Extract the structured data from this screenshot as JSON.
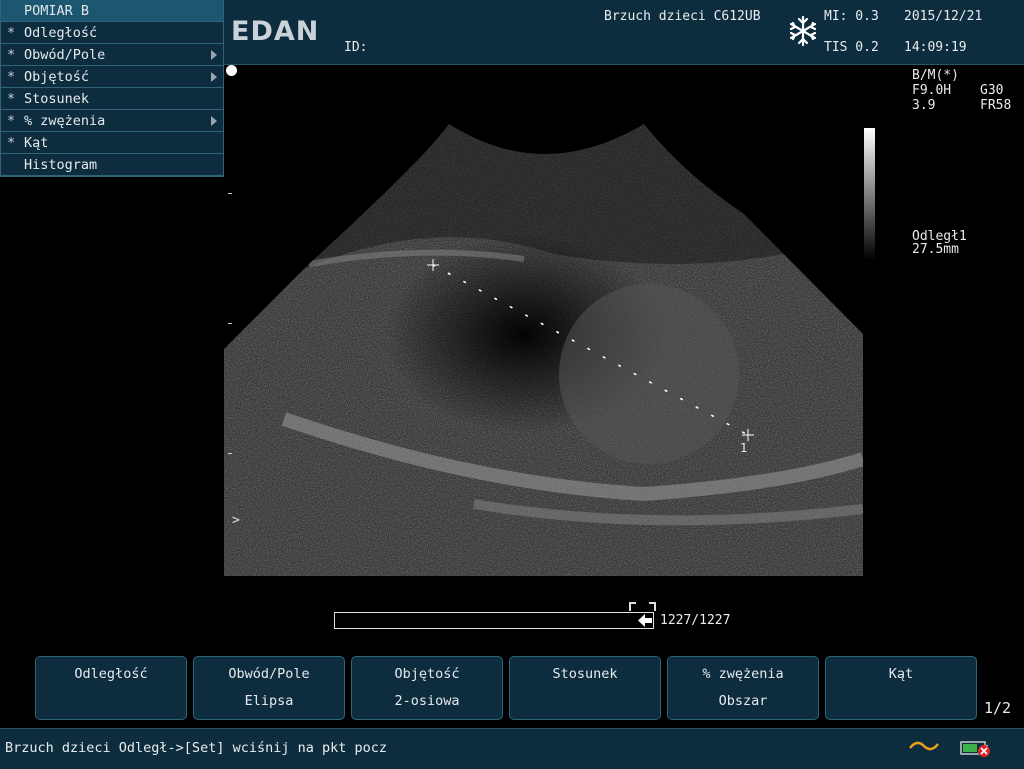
{
  "header": {
    "logo": "EDAN",
    "id_label": "ID:",
    "exam_name": "Brzuch dzieci C612UB",
    "mi": "MI: 0.3",
    "tis": "TIS 0.2",
    "date": "2015/12/21",
    "time": "14:09:19"
  },
  "menu": {
    "title": "POMIAR B",
    "items": [
      {
        "label": "Odległość",
        "star": "*",
        "submenu": false
      },
      {
        "label": "Obwód/Pole",
        "star": "*",
        "submenu": true
      },
      {
        "label": "Objętość",
        "star": "*",
        "submenu": true
      },
      {
        "label": "Stosunek",
        "star": "*",
        "submenu": false
      },
      {
        "label": "% zwężenia",
        "star": "*",
        "submenu": true
      },
      {
        "label": "Kąt",
        "star": "*",
        "submenu": false
      },
      {
        "label": "Histogram",
        "star": "",
        "submenu": false
      }
    ]
  },
  "image_params": {
    "mode": "B/M(*)",
    "frequency": "F9.0H",
    "gain": "G30",
    "depth": "3.9",
    "frame_rate": "FR58"
  },
  "measurement": {
    "name": "Odległ1",
    "value": "27.5mm",
    "marker": "1"
  },
  "focus_marker": ">",
  "cine": {
    "counter": "1227/1227",
    "position": 1.0
  },
  "softkeys": [
    {
      "line1": "Odległość",
      "line2": ""
    },
    {
      "line1": "Obwód/Pole",
      "line2": "Elipsa"
    },
    {
      "line1": "Objętość",
      "line2": "2-osiowa"
    },
    {
      "line1": "Stosunek",
      "line2": ""
    },
    {
      "line1": "% zwężenia",
      "line2": "Obszar"
    },
    {
      "line1": "Kąt",
      "line2": ""
    }
  ],
  "page_indicator": "1/2",
  "status": {
    "text": "Brzuch dzieci  Odległ->[Set] wciśnij na pkt pocz"
  },
  "icons": {
    "freeze": "snowflake-icon",
    "power": "ac-power-icon",
    "battery": "battery-icon"
  },
  "colors": {
    "panel": "#0d2d3e",
    "panel_border": "#2f6378",
    "menu_title": "#1d5670"
  }
}
